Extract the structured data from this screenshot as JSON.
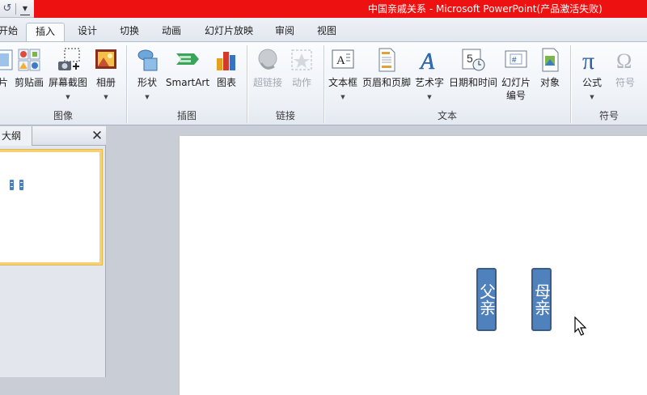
{
  "window": {
    "title": "中国亲戚关系  -  Microsoft PowerPoint(产品激活失败)",
    "quick_access": {
      "undo_icon": "undo-icon",
      "customize_icon": "qat-customize-icon"
    },
    "title_color": "#ee1111"
  },
  "tabs": [
    {
      "label": "开始",
      "active": false
    },
    {
      "label": "插入",
      "active": true
    },
    {
      "label": "设计",
      "active": false
    },
    {
      "label": "切换",
      "active": false
    },
    {
      "label": "动画",
      "active": false
    },
    {
      "label": "幻灯片放映",
      "active": false
    },
    {
      "label": "审阅",
      "active": false
    },
    {
      "label": "视图",
      "active": false
    }
  ],
  "ribbon": {
    "groups": {
      "images": {
        "label": "图像",
        "buttons": [
          {
            "label": "片",
            "icon": "picture-icon"
          },
          {
            "label": "剪贴画",
            "icon": "clipart-icon"
          },
          {
            "label": "屏幕截图",
            "icon": "screenshot-icon"
          },
          {
            "label": "相册",
            "icon": "photo-album-icon"
          }
        ]
      },
      "illustrations": {
        "label": "插图",
        "buttons": [
          {
            "label": "形状",
            "icon": "shapes-icon"
          },
          {
            "label": "SmartArt",
            "icon": "smartart-icon"
          },
          {
            "label": "图表",
            "icon": "chart-icon"
          }
        ]
      },
      "links": {
        "label": "链接",
        "buttons": [
          {
            "label": "超链接",
            "icon": "hyperlink-icon",
            "enabled": false
          },
          {
            "label": "动作",
            "icon": "action-icon",
            "enabled": false
          }
        ]
      },
      "text": {
        "label": "文本",
        "buttons": [
          {
            "label": "文本框",
            "icon": "textbox-icon"
          },
          {
            "label": "页眉和页脚",
            "icon": "header-footer-icon"
          },
          {
            "label": "艺术字",
            "icon": "wordart-icon"
          },
          {
            "label": "日期和时间",
            "icon": "date-time-icon"
          },
          {
            "label": "幻灯片",
            "label2": "编号",
            "icon": "slide-number-icon"
          },
          {
            "label": "对象",
            "icon": "object-icon"
          }
        ]
      },
      "symbols": {
        "label": "符号",
        "buttons": [
          {
            "label": "公式",
            "icon": "equation-icon"
          },
          {
            "label": "符号",
            "icon": "symbol-icon",
            "enabled": false
          }
        ]
      }
    }
  },
  "left_pane": {
    "tab_outline": "大纲",
    "close_icon": "close-icon"
  },
  "slide": {
    "nodes": [
      {
        "text": "父亲"
      },
      {
        "text": "母亲"
      }
    ],
    "node_color": "#4f81bd"
  }
}
